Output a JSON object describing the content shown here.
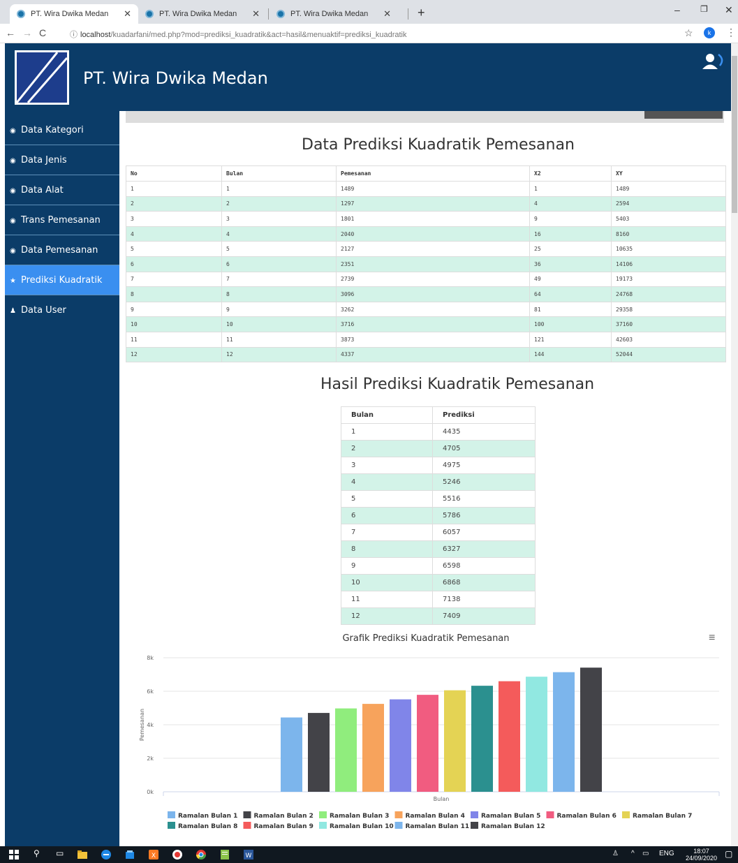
{
  "browser": {
    "tabs": [
      {
        "title": "PT. Wira Dwika Medan"
      },
      {
        "title": "PT. Wira Dwika Medan"
      },
      {
        "title": "PT. Wira Dwika Medan"
      }
    ],
    "url_host": "localhost",
    "url_path": "/kuadarfani/med.php?mod=prediksi_kuadratik&act=hasil&menuaktif=prediksi_kuadratik",
    "profile_initial": "k"
  },
  "header": {
    "title": "PT. Wira Dwika Medan"
  },
  "sidebar": {
    "items": [
      {
        "label": "Data Kategori",
        "icon": "dashboard-icon"
      },
      {
        "label": "Data Jenis",
        "icon": "dashboard-icon"
      },
      {
        "label": "Data Alat",
        "icon": "dashboard-icon"
      },
      {
        "label": "Trans Pemesanan",
        "icon": "dashboard-icon"
      },
      {
        "label": "Data Pemesanan",
        "icon": "dashboard-icon"
      },
      {
        "label": "Prediksi Kuadratik",
        "icon": "star-icon",
        "active": true
      },
      {
        "label": "Data User",
        "icon": "user-icon"
      }
    ]
  },
  "section1": {
    "title": "Data Prediksi Kuadratik Pemesanan",
    "columns": [
      "No",
      "Bulan",
      "Pemesanan",
      "X2",
      "XY"
    ],
    "rows": [
      [
        "1",
        "1",
        "1489",
        "1",
        "1489"
      ],
      [
        "2",
        "2",
        "1297",
        "4",
        "2594"
      ],
      [
        "3",
        "3",
        "1801",
        "9",
        "5403"
      ],
      [
        "4",
        "4",
        "2040",
        "16",
        "8160"
      ],
      [
        "5",
        "5",
        "2127",
        "25",
        "10635"
      ],
      [
        "6",
        "6",
        "2351",
        "36",
        "14106"
      ],
      [
        "7",
        "7",
        "2739",
        "49",
        "19173"
      ],
      [
        "8",
        "8",
        "3096",
        "64",
        "24768"
      ],
      [
        "9",
        "9",
        "3262",
        "81",
        "29358"
      ],
      [
        "10",
        "10",
        "3716",
        "100",
        "37160"
      ],
      [
        "11",
        "11",
        "3873",
        "121",
        "42603"
      ],
      [
        "12",
        "12",
        "4337",
        "144",
        "52044"
      ]
    ]
  },
  "section2": {
    "title": "Hasil Prediksi Kuadratik Pemesanan",
    "columns": [
      "Bulan",
      "Prediksi"
    ],
    "rows": [
      [
        "1",
        "4435"
      ],
      [
        "2",
        "4705"
      ],
      [
        "3",
        "4975"
      ],
      [
        "4",
        "5246"
      ],
      [
        "5",
        "5516"
      ],
      [
        "6",
        "5786"
      ],
      [
        "7",
        "6057"
      ],
      [
        "8",
        "6327"
      ],
      [
        "9",
        "6598"
      ],
      [
        "10",
        "6868"
      ],
      [
        "11",
        "7138"
      ],
      [
        "12",
        "7409"
      ]
    ]
  },
  "chart_data": {
    "type": "bar",
    "title": "Grafik Prediksi Kuadratik Pemesanan",
    "xlabel": "Bulan",
    "ylabel": "Pemesanan",
    "ylim": [
      0,
      8000
    ],
    "yticks": [
      "0k",
      "2k",
      "4k",
      "6k",
      "8k"
    ],
    "grid": true,
    "legend": "bottom",
    "series": [
      {
        "name": "Ramalan Bulan 1",
        "values": [
          4435
        ],
        "color": "#7cb5ec"
      },
      {
        "name": "Ramalan Bulan 2",
        "values": [
          4705
        ],
        "color": "#434348"
      },
      {
        "name": "Ramalan Bulan 3",
        "values": [
          4975
        ],
        "color": "#90ed7d"
      },
      {
        "name": "Ramalan Bulan 4",
        "values": [
          5246
        ],
        "color": "#f7a35c"
      },
      {
        "name": "Ramalan Bulan 5",
        "values": [
          5516
        ],
        "color": "#8085e9"
      },
      {
        "name": "Ramalan Bulan 6",
        "values": [
          5786
        ],
        "color": "#f15c80"
      },
      {
        "name": "Ramalan Bulan 7",
        "values": [
          6057
        ],
        "color": "#e4d354"
      },
      {
        "name": "Ramalan Bulan 8",
        "values": [
          6327
        ],
        "color": "#2b908f"
      },
      {
        "name": "Ramalan Bulan 9",
        "values": [
          6598
        ],
        "color": "#f45b5b"
      },
      {
        "name": "Ramalan Bulan 10",
        "values": [
          6868
        ],
        "color": "#91e8e1"
      },
      {
        "name": "Ramalan Bulan 11",
        "values": [
          7138
        ],
        "color": "#7cb5ec"
      },
      {
        "name": "Ramalan Bulan 12",
        "values": [
          7409
        ],
        "color": "#434348"
      }
    ]
  },
  "taskbar": {
    "language": "ENG",
    "time": "18:07",
    "date": "24/09/2020"
  }
}
